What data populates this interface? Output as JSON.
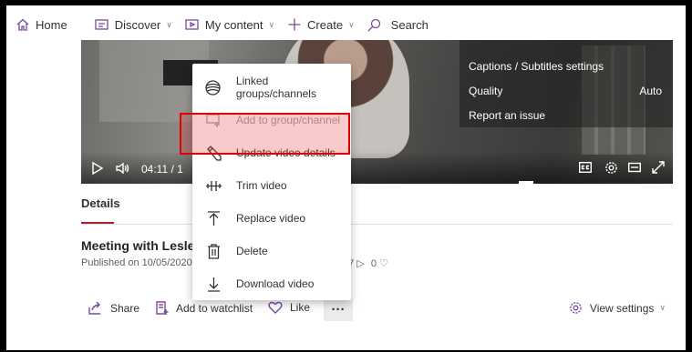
{
  "nav": {
    "home": "Home",
    "discover": "Discover",
    "my_content": "My content",
    "create": "Create",
    "search": "Search"
  },
  "player": {
    "settings_menu": {
      "captions": "Captions / Subtitles settings",
      "quality": "Quality",
      "quality_value": "Auto",
      "report": "Report an issue"
    },
    "time": "04:11 / 1"
  },
  "tabs": {
    "details": "Details"
  },
  "video": {
    "title": "Meeting with Lesley",
    "published": "Published on 10/05/2020",
    "views": "17",
    "likes": "0"
  },
  "actions": {
    "share": "Share",
    "watchlist": "Add to watchlist",
    "like": "Like",
    "more": "···",
    "view_settings": "View settings"
  },
  "menu": {
    "items": [
      {
        "label": "Linked groups/channels",
        "icon": "layers-icon",
        "enabled": true
      },
      {
        "label": "Add to group/channel",
        "icon": "add-to-group-icon",
        "enabled": false
      },
      {
        "label": "Update video details",
        "icon": "pencil-icon",
        "enabled": true
      },
      {
        "label": "Trim video",
        "icon": "trim-icon",
        "enabled": true
      },
      {
        "label": "Replace video",
        "icon": "upload-icon",
        "enabled": true
      },
      {
        "label": "Delete",
        "icon": "trash-icon",
        "enabled": true
      },
      {
        "label": "Download video",
        "icon": "download-icon",
        "enabled": true
      }
    ]
  },
  "colors": {
    "accent": "#7a4a9c",
    "highlight_border": "#e00000",
    "tab_underline": "#a4262c"
  }
}
